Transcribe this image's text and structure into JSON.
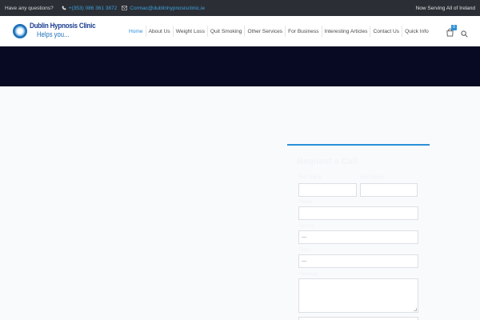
{
  "topbar": {
    "question": "Have any questions?",
    "phone": "+(353) 086 361 3872",
    "email": "Cormac@dublinhypnosisclinic.ie",
    "serving": "Now Serving All of Ireland"
  },
  "brand": {
    "name": "Dublin Hypnosis Clinic",
    "tagline": "Helps you..."
  },
  "nav": {
    "items": [
      {
        "label": "Home"
      },
      {
        "label": "About Us"
      },
      {
        "label": "Weight Loss"
      },
      {
        "label": "Quit Smoking"
      },
      {
        "label": "Other Services"
      },
      {
        "label": "For Business"
      },
      {
        "label": "Interesting Articles"
      },
      {
        "label": "Contact Us"
      },
      {
        "label": "Quick Info"
      }
    ],
    "cart_count": "0"
  },
  "form": {
    "title": "Request a Call",
    "first_name_label": "First Name",
    "last_name_label": "Last Name",
    "phone_label": "Phone",
    "select1_label": "Service",
    "select1_value": "---",
    "select2_label": "Time",
    "select2_value": "---",
    "message_label": "Message"
  },
  "colors": {
    "accent": "#2a8fd8",
    "topbar_bg": "#2b2e35",
    "hero_bg": "#070a22"
  }
}
